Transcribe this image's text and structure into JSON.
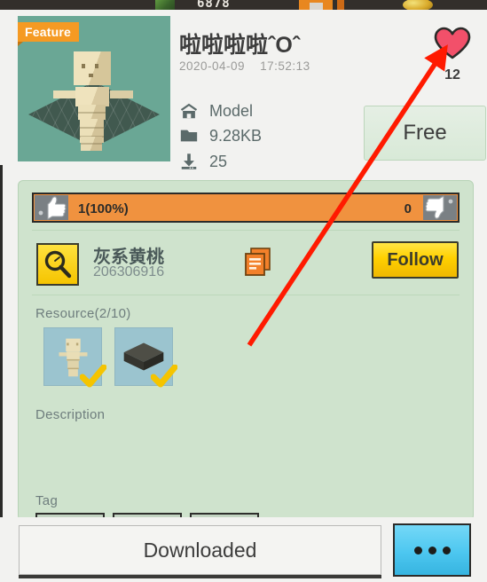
{
  "hud": {
    "score": "6878",
    "coin_icon": "coin-icon",
    "green_icon": "leaf-icon"
  },
  "header": {
    "feature_badge": "Feature",
    "preview_alt": "voxel-character-model-preview",
    "title": "啦啦啦啦ˆOˆ",
    "date": "2020-04-09",
    "time": "17:52:13",
    "meta": [
      {
        "icon": "house-icon",
        "label": "Model"
      },
      {
        "icon": "folder-icon",
        "label": "9.28KB"
      },
      {
        "icon": "download-icon",
        "label": "25"
      }
    ],
    "like_icon": "heart-icon",
    "like_count": "12",
    "price_label": "Free"
  },
  "rating": {
    "thumb_up_icon": "thumbs-up-icon",
    "up_label": "1(100%)",
    "thumb_down_icon": "thumbs-down-icon",
    "down_label": "0",
    "fill_color": "#f0923f"
  },
  "author": {
    "avatar_icon": "magnifier-icon",
    "name": "灰系黄桃",
    "id": "206306916",
    "copy_icon": "copy-documents-icon",
    "follow_label": "Follow"
  },
  "resource": {
    "label": "Resource(2/10)",
    "items": [
      {
        "name": "character-thumbnail",
        "checked_icon": "check-icon"
      },
      {
        "name": "block-thumbnail",
        "checked_icon": "check-icon"
      }
    ]
  },
  "description": {
    "label": "Description",
    "text": ""
  },
  "tags": {
    "label": "Tag",
    "chips": [
      "",
      "",
      ""
    ]
  },
  "bottom": {
    "download_label": "Downloaded",
    "more_icon": "ellipsis-icon"
  },
  "annotation": {
    "arrow_color": "#ff1a00",
    "points_to": "heart-icon"
  },
  "colors": {
    "card_bg": "#cfe3cd",
    "page_bg": "#f2f2f0",
    "accent_orange": "#f59a23",
    "accent_yellow": "#ffd000",
    "heart_pink": "#f2506a"
  }
}
